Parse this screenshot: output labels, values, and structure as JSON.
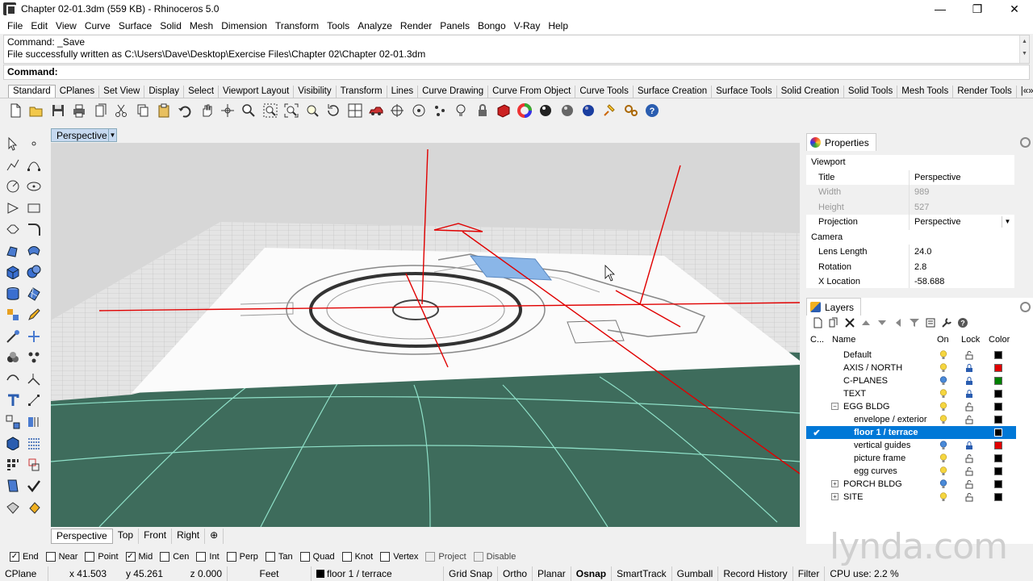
{
  "window": {
    "title": "Chapter 02-01.3dm (559 KB) - Rhinoceros 5.0",
    "minimize": "—",
    "restore": "❐",
    "close": "✕"
  },
  "menu": [
    "File",
    "Edit",
    "View",
    "Curve",
    "Surface",
    "Solid",
    "Mesh",
    "Dimension",
    "Transform",
    "Tools",
    "Analyze",
    "Render",
    "Panels",
    "Bongo",
    "V-Ray",
    "Help"
  ],
  "command": {
    "history_line1": "Command: _Save",
    "history_line2": "File successfully written as C:\\Users\\Dave\\Desktop\\Exercise Files\\Chapter 02\\Chapter 02-01.3dm",
    "prompt": "Command:"
  },
  "toolbar_tabs": [
    "Standard",
    "CPlanes",
    "Set View",
    "Display",
    "Select",
    "Viewport Layout",
    "Visibility",
    "Transform",
    "Lines",
    "Curve Drawing",
    "Curve From Object",
    "Curve Tools",
    "Surface Creation",
    "Surface Tools",
    "Solid Creation",
    "Solid Tools",
    "Mesh Tools",
    "Render Tools",
    "|«»"
  ],
  "toolbar_icons": [
    "new-icon",
    "open-icon",
    "save-icon",
    "print-icon",
    "import-icon",
    "cut-icon",
    "copy-icon",
    "paste-icon",
    "undo-icon",
    "pan-icon",
    "rotate-view-icon",
    "zoom-icon",
    "zoom-window-icon",
    "zoom-extents-icon",
    "zoom-selected-icon",
    "rotate-icon",
    "four-viewports-icon",
    "car-icon",
    "osnap-icon",
    "cplane-icon",
    "points-icon",
    "light-icon",
    "lock-icon",
    "box-render-icon",
    "color-wheel-icon",
    "sphere-icon",
    "sphere-gray-icon",
    "sphere-blue-icon",
    "lightbulb-icon",
    "options-icon",
    "help-icon"
  ],
  "viewport": {
    "title": "Perspective",
    "tabs": [
      "Perspective",
      "Top",
      "Front",
      "Right"
    ],
    "add_tab": "⊕"
  },
  "properties": {
    "tab": "Properties",
    "sections": [
      {
        "label": "Viewport"
      },
      {
        "label": "Camera"
      }
    ],
    "rows": [
      {
        "label": "Title",
        "value": "Perspective"
      },
      {
        "label": "Width",
        "value": "989"
      },
      {
        "label": "Height",
        "value": "527"
      },
      {
        "label": "Projection",
        "value": "Perspective"
      },
      {
        "label": "Lens Length",
        "value": "24.0"
      },
      {
        "label": "Rotation",
        "value": "2.8"
      },
      {
        "label": "X Location",
        "value": "-58.688"
      }
    ]
  },
  "layers": {
    "tab": "Layers",
    "headers": {
      "c": "C...",
      "name": "Name",
      "on": "On",
      "lock": "Lock",
      "color": "Color"
    },
    "rows": [
      {
        "name": "Default",
        "color": "#000000"
      },
      {
        "name": "AXIS / NORTH",
        "color": "#e00000"
      },
      {
        "name": "C-PLANES",
        "color": "#008000"
      },
      {
        "name": "TEXT",
        "color": "#000000"
      },
      {
        "name": "EGG BLDG",
        "color": "#000000",
        "toggle": "−"
      },
      {
        "name": "envelope / exterior",
        "color": "#000000"
      },
      {
        "name": "floor 1 / terrace",
        "color": "#000000",
        "check": "✔"
      },
      {
        "name": "vertical guides",
        "color": "#e00000"
      },
      {
        "name": "picture frame",
        "color": "#000000"
      },
      {
        "name": "egg curves",
        "color": "#000000"
      },
      {
        "name": "PORCH BLDG",
        "color": "#000000",
        "toggle": "+"
      },
      {
        "name": "SITE",
        "color": "#000000",
        "toggle": "+"
      }
    ]
  },
  "osnap": [
    {
      "label": "End",
      "checked": true
    },
    {
      "label": "Near",
      "checked": false
    },
    {
      "label": "Point",
      "checked": false
    },
    {
      "label": "Mid",
      "checked": true
    },
    {
      "label": "Cen",
      "checked": false
    },
    {
      "label": "Int",
      "checked": false
    },
    {
      "label": "Perp",
      "checked": false
    },
    {
      "label": "Tan",
      "checked": false
    },
    {
      "label": "Quad",
      "checked": false
    },
    {
      "label": "Knot",
      "checked": false
    },
    {
      "label": "Vertex",
      "checked": false
    },
    {
      "label": "Project",
      "checked": false
    },
    {
      "label": "Disable",
      "checked": false
    }
  ],
  "status": {
    "cplane": "CPlane",
    "x": "x 41.503",
    "y": "y 45.261",
    "z": "z 0.000",
    "units": "Feet",
    "layer": "floor 1 / terrace",
    "grid_snap": "Grid Snap",
    "ortho": "Ortho",
    "planar": "Planar",
    "osnap": "Osnap",
    "smarttrack": "SmartTrack",
    "gumball": "Gumball",
    "record_history": "Record History",
    "filter": "Filter",
    "cpu": "CPU use: 2.2 %"
  },
  "watermark": "lynda.com",
  "colors": {
    "accent": "#0078d7",
    "axis_red": "#e00000",
    "ground": "#3d6e5e",
    "viewport_title": "#c6d9f0"
  }
}
